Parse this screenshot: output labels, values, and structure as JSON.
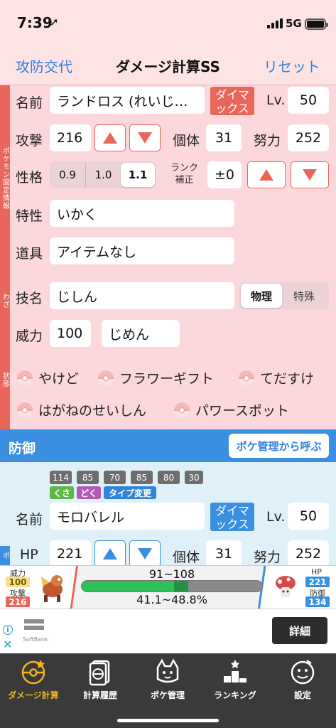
{
  "status": {
    "time": "7:39",
    "network": "5G"
  },
  "nav": {
    "left": "攻防交代",
    "title": "ダメージ計算SS",
    "right": "リセット"
  },
  "attacker": {
    "rail_pokemon": "ポケモン固定情報",
    "rail_move": "わざ",
    "rail_status": "状態",
    "name_label": "名前",
    "name_value": "ランドロス (れいじ…",
    "dmax": "ダイマックス",
    "lv_label": "Lv.",
    "lv_value": "50",
    "atk_label": "攻撃",
    "atk_value": "216",
    "iv_label": "個体",
    "iv_value": "31",
    "ev_label": "努力",
    "ev_value": "252",
    "nature_label": "性格",
    "nature_options": [
      "0.9",
      "1.0",
      "1.1"
    ],
    "nature_selected": "1.1",
    "rank_label": "ランク補正",
    "rank_label_line1": "ランク",
    "rank_label_line2": "補正",
    "rank_value": "±0",
    "ability_label": "特性",
    "ability_value": "いかく",
    "item_label": "道具",
    "item_value": "アイテムなし",
    "move_label": "技名",
    "move_value": "じしん",
    "category_options": [
      "物理",
      "特殊"
    ],
    "category_selected": "物理",
    "power_label": "威力",
    "power_value": "100",
    "terrain_value": "じめん",
    "conditions": [
      "やけど",
      "フラワーギフト",
      "てだすけ",
      "はがねのせいしん",
      "パワースポット"
    ]
  },
  "defender": {
    "header": "防御",
    "call_button": "ポケ管理から呼ぶ",
    "base_stats": [
      "114",
      "85",
      "70",
      "85",
      "80",
      "30"
    ],
    "types": [
      "くさ",
      "どく"
    ],
    "type_change": "タイプ変更",
    "name_label": "名前",
    "name_value": "モロバレル",
    "dmax": "ダイマックス",
    "lv_label": "Lv.",
    "lv_value": "50",
    "hp_label": "HP",
    "hp_value": "221",
    "iv_label": "個体",
    "iv_value": "31",
    "ev_label": "努力",
    "ev_value": "252",
    "rail_partial": "ポ"
  },
  "result": {
    "power_label": "威力",
    "power_value": "100",
    "atk_label": "攻撃",
    "atk_value": "216",
    "damage_range": "91~108",
    "percent_range": "41.1~48.8%",
    "hp_label": "HP",
    "hp_value": "221",
    "def_label": "防御",
    "def_value": "134",
    "remaining_min_fraction": 0.512,
    "remaining_max_fraction": 0.589
  },
  "ad": {
    "brand": "SoftBank",
    "cta": "詳細"
  },
  "tabs": [
    {
      "label": "ダメージ計算",
      "icon": "pokeball-calculator-icon",
      "active": true
    },
    {
      "label": "計算履歴",
      "icon": "history-icon",
      "active": false
    },
    {
      "label": "ポケ管理",
      "icon": "pokemon-box-icon",
      "active": false
    },
    {
      "label": "ランキング",
      "icon": "ranking-podium-icon",
      "active": false
    },
    {
      "label": "設定",
      "icon": "settings-icon",
      "active": false
    }
  ],
  "colors": {
    "attack_bg": "#fcd7dc",
    "attack_accent": "#e8665a",
    "defense_accent": "#3b8fe0",
    "link_blue": "#2f7fe0",
    "hp_green": "#2fbf57",
    "tab_active": "#f2b420"
  }
}
